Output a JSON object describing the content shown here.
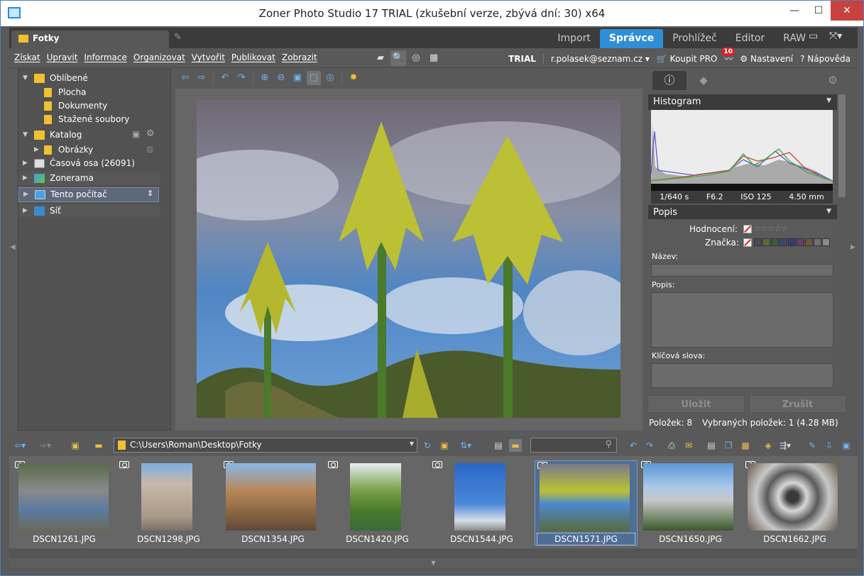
{
  "window": {
    "title": "Zoner Photo Studio 17 TRIAL (zkušební verze, zbývá dní: 30) x64"
  },
  "workspace_tab": {
    "label": "Fotky"
  },
  "mode_tabs": [
    {
      "label": "Import",
      "active": false
    },
    {
      "label": "Správce",
      "active": true
    },
    {
      "label": "Prohlížeč",
      "active": false
    },
    {
      "label": "Editor",
      "active": false
    },
    {
      "label": "RAW",
      "active": false
    }
  ],
  "menu": [
    "Získat",
    "Upravit",
    "Informace",
    "Organizovat",
    "Vytvořit",
    "Publikovat",
    "Zobrazit"
  ],
  "account": {
    "trial": "TRIAL",
    "email": "r.polasek@seznam.cz",
    "buy": "Koupit PRO",
    "notifications": "10",
    "settings": "Nastavení",
    "help": "Nápověda"
  },
  "tree": {
    "favorites": "Oblíbené",
    "plocha": "Plocha",
    "dokumenty": "Dokumenty",
    "stazene": "Stažené soubory",
    "katalog": "Katalog",
    "obrazky": "Obrázky",
    "timeline": "Časová osa (26091)",
    "zonerama": "Zonerama",
    "computer": "Tento počítač",
    "network": "Síť"
  },
  "info_panel": {
    "histogram_title": "Histogram",
    "exif": {
      "shutter": "1/640 s",
      "aperture": "F6.2",
      "iso": "ISO 125",
      "focal": "4.50 mm"
    },
    "popis_title": "Popis",
    "rating_label": "Hodnocení:",
    "tag_label": "Značka:",
    "name_label": "Název:",
    "desc_label": "Popis:",
    "keywords_label": "Klíčová slova:",
    "save": "Uložit",
    "cancel": "Zrušit",
    "items": "Položek: 8",
    "selected": "Vybraných položek: 1 (4.28 MB)",
    "tag_colors": [
      "#4c4c4c",
      "#5a6b3a",
      "#3e5a3a",
      "#3a4a6b",
      "#363c6a",
      "#6a3a6a",
      "#6a5a3a",
      "#707070",
      "#8a8a8a"
    ]
  },
  "address": {
    "path": "C:\\Users\\Roman\\Desktop\\Fotky",
    "search_placeholder": ""
  },
  "thumbnails": [
    {
      "name": "DSCN1261.JPG",
      "selected": false
    },
    {
      "name": "DSCN1298.JPG",
      "selected": false
    },
    {
      "name": "DSCN1354.JPG",
      "selected": false
    },
    {
      "name": "DSCN1420.JPG",
      "selected": false
    },
    {
      "name": "DSCN1544.JPG",
      "selected": false
    },
    {
      "name": "DSCN1571.JPG",
      "selected": true
    },
    {
      "name": "DSCN1650.JPG",
      "selected": false
    },
    {
      "name": "DSCN1662.JPG",
      "selected": false
    }
  ]
}
